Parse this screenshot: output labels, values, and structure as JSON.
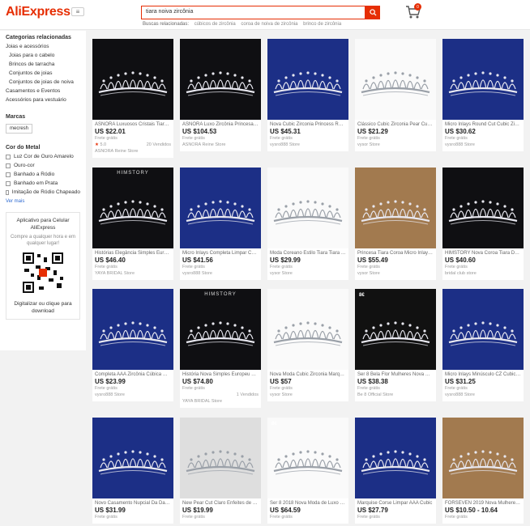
{
  "header": {
    "logo": "AliExpress",
    "search_value": "tiara noiva zircônia",
    "related_label": "Buscas relacionadas:",
    "related": [
      "cúbicos de zircônia",
      "coroa de noiva de zircônia",
      "brinco de zircônia"
    ],
    "cart_count": "0",
    "brand_color": "#e62e04"
  },
  "sidebar": {
    "categories_title": "Categorias relacionadas",
    "categories": [
      {
        "label": "Joias e acessórios",
        "sub": false
      },
      {
        "label": "Joias para o cabelo",
        "sub": true
      },
      {
        "label": "Brincos de tarracha",
        "sub": true
      },
      {
        "label": "Conjuntos de joias",
        "sub": true
      },
      {
        "label": "Conjuntos de joias de noiva",
        "sub": true
      },
      {
        "label": "Casamentos e Eventos",
        "sub": false
      },
      {
        "label": "Acessórios para vestuário",
        "sub": false
      }
    ],
    "brands_title": "Marcas",
    "brand": "mecresh",
    "metal_title": "Cor do Metal",
    "metals": [
      "Luz Cor de Ouro Amarelo",
      "Ouro-cor",
      "Banhado a Ródio",
      "Banhado em Prata",
      "Imitação de Ródio Chapeado"
    ],
    "see_more": "Ver mais",
    "app_title": "Aplicativo para Celular AliExpress",
    "app_sub": "Compre a qualquer hora e em qualquer lugar!",
    "app_foot": "Digitalizar ou clique para download"
  },
  "products": [
    {
      "title": "ASNORA Luxuosos Cristais Tiara nupcial",
      "price": "US $22.01",
      "ship": "Frete grátis",
      "rating": "5.0",
      "sold": "20 Vendidos",
      "store": "ASNORA Reine Store",
      "bg": "dark"
    },
    {
      "title": "ASNORA Luxo Zircônia Princesa Coroa",
      "price": "US $104.53",
      "ship": "Frete grátis",
      "store": "ASNORA Reine Store",
      "bg": "dark"
    },
    {
      "title": "Nova Cubic Zirconia Princess Royal Tiara",
      "price": "US $45.31",
      "ship": "Frete grátis",
      "store": "vysro888 Store",
      "bg": "blue"
    },
    {
      "title": "Clássico Cubic Zirconia Pear Cut Zircônia",
      "price": "US $21.29",
      "ship": "Frete grátis",
      "store": "vysor Store",
      "bg": "white"
    },
    {
      "title": "Micro Inlays Round Cut Cubic Zirconia",
      "price": "US $30.62",
      "ship": "Frete grátis",
      "store": "vysro888 Store",
      "bg": "blue"
    },
    {
      "title": "Histórias Elegância Simples Europeia",
      "price": "US $46.40",
      "ship": "Frete grátis",
      "store": "YAYA BRIDAL Store",
      "bg": "dark",
      "badge": "HIMSTORY"
    },
    {
      "title": "Micro Inlays Completa Limpar Cubic",
      "price": "US $41.56",
      "ship": "Frete grátis",
      "store": "vysro888 Store",
      "bg": "blue"
    },
    {
      "title": "Moda Coreano Estilo Tiara Tiara Luxo",
      "price": "US $29.99",
      "ship": "Frete grátis",
      "store": "vysor Store",
      "bg": "white"
    },
    {
      "title": "Princesa Tiara Coroa Micro Inlays Zircônia",
      "price": "US $55.49",
      "ship": "Frete grátis",
      "store": "vysor Store",
      "bg": "brown"
    },
    {
      "title": "HIMSTORY Nova Coroa Tiara Da Corte",
      "price": "US $40.60",
      "ship": "Frete grátis",
      "store": "bridal club store",
      "bg": "dark"
    },
    {
      "title": "Completa AAA Zircônia Cúbica Clara",
      "price": "US $23.99",
      "ship": "Frete grátis",
      "store": "vysro888 Store",
      "bg": "blue"
    },
    {
      "title": "História Nova Simples Europeu Coroa",
      "price": "US $74.80",
      "ship": "Frete grátis",
      "sold": "1 Vendidos",
      "store": "YAYA BRIDAL Store",
      "bg": "dark",
      "badge": "HIMSTORY"
    },
    {
      "title": "Nova Moda Cubic Zirconia Marquise",
      "price": "US $57",
      "ship": "Frete grátis",
      "store": "vysor Store",
      "bg": "white"
    },
    {
      "title": "Ser 8 Bela Flor Mulheres Nova Olivine",
      "price": "US $38.38",
      "ship": "Frete grátis",
      "store": "Be 8 Official Store",
      "bg": "black2",
      "badge": "8€"
    },
    {
      "title": "Micro Inlays Minúsculo CZ Cubic Zircônia",
      "price": "US $31.25",
      "ship": "Frete grátis",
      "store": "vysro888 Store",
      "bg": "blue"
    },
    {
      "title": "Novo Casamento Nupcial Da Dama",
      "price": "US $31.99",
      "ship": "Frete grátis",
      "store": "",
      "bg": "blue"
    },
    {
      "title": "New Pear Cut Claro Enfeites de Cabelo",
      "price": "US $19.99",
      "ship": "Frete grátis",
      "store": "",
      "bg": "gray"
    },
    {
      "title": "Ser 8 2018 Nova Moda de Luxo Mulheres",
      "price": "US $64.59",
      "ship": "Frete grátis",
      "store": "",
      "bg": "white",
      "badge": "8€"
    },
    {
      "title": "Marquise Corse Limpar AAA Cubic",
      "price": "US $27.79",
      "ship": "Frete grátis",
      "store": "",
      "bg": "blue"
    },
    {
      "title": "FORSEVEN 2019 Nova Mulheres Dourado",
      "price": "US $10.50 - 10.64",
      "ship": "Frete grátis",
      "store": "",
      "bg": "brown"
    }
  ]
}
